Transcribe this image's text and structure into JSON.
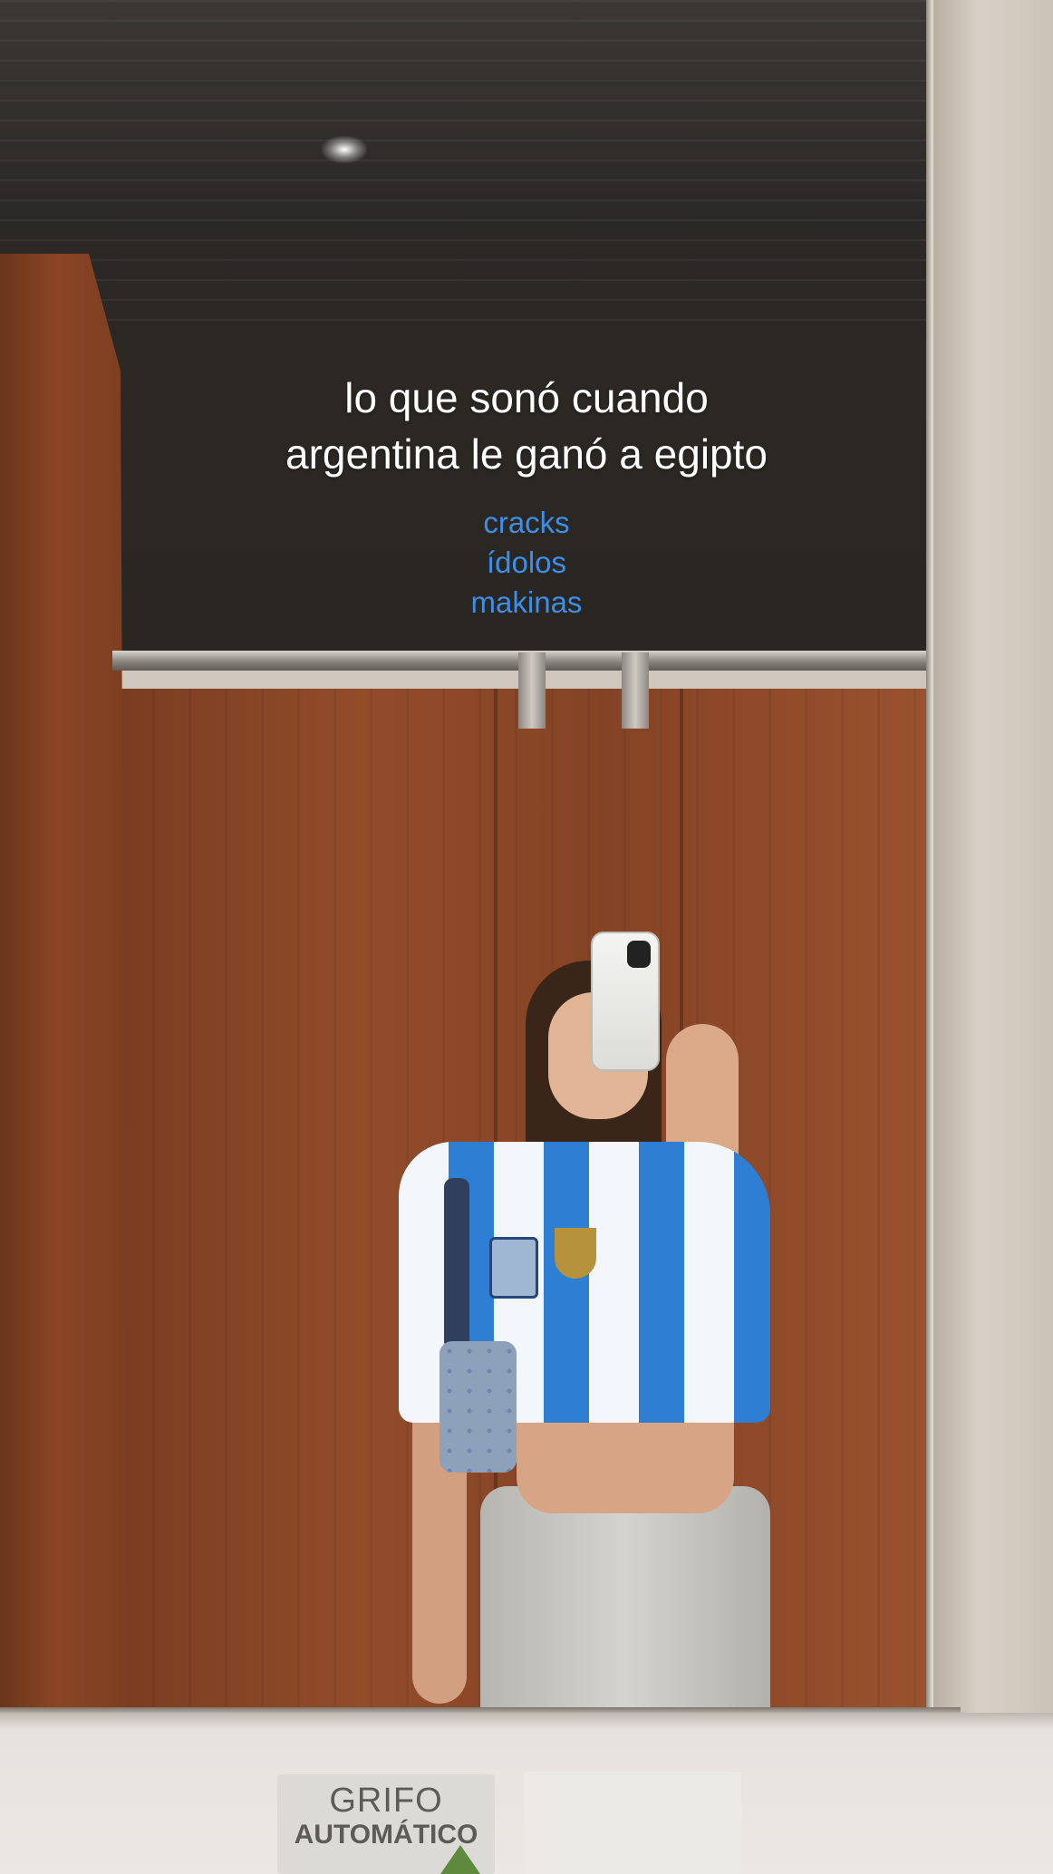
{
  "caption": {
    "line1": "lo que sonó cuando",
    "line2": "argentina le ganó a egipto"
  },
  "tags": {
    "items": [
      "cracks",
      "ídolos",
      "makinas"
    ],
    "color": "#3d8ee6"
  },
  "sign": {
    "line1": "GRIFO",
    "line2": "AUTOMÁTICO"
  }
}
